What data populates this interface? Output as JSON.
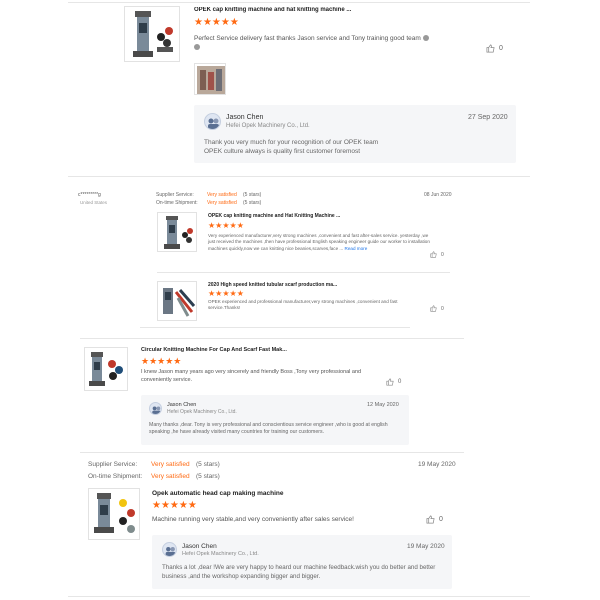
{
  "colors": {
    "accent": "#ff6a13",
    "link": "#1a73e8"
  },
  "review1": {
    "product_title": "OPEK cap knitting machine and hat knitting machine ...",
    "stars": "★★★★★",
    "text": "Perfect Service delivery fast thanks Jason service and Tony training good team",
    "like_count": "0",
    "reply": {
      "name": "Jason Chen",
      "company": "Hefei Opek Machinery Co., Ltd.",
      "date": "27 Sep 2020",
      "text_line1": "Thank you very much for your recognition of our OPEK team",
      "text_line2": "OPEK  culture always is quality first  customer foremost"
    }
  },
  "review2": {
    "user": "c*********g",
    "country": "United States",
    "supplier_service_label": "Supplier Service:",
    "supplier_service_value": "Very satisfied",
    "supplier_service_stars": "(5 stars)",
    "ontime_label": "On-time Shipment:",
    "ontime_value": "Very satisfied",
    "ontime_stars": "(5 stars)",
    "date": "08 Jun 2020",
    "item1": {
      "title": "OPEK cap knitting machine and Hat Knitting Machine ...",
      "stars": "★★★★★",
      "text": "Very experienced manufacturer,very strong machines ,convenient and fast after-sales service. yesterday ,we just received the machines ,then have professional English speaking engineer guide our worker to installation machines quickly,now we can knitting nice beanies,scarves,face ...",
      "read_more": "Read more",
      "like_count": "0"
    },
    "item2": {
      "title": "2020 High speed knitted tubular scarf production ma...",
      "stars": "★★★★★",
      "text": "OPEK experienced and professional manufacturer,very strong machines ,convenient and fast service.Thanks!",
      "like_count": "0"
    }
  },
  "review3": {
    "product_title": "Circular Knitting Machine For Cap And Scarf Fast Mak...",
    "stars": "★★★★★",
    "text": "I knew Jason many years ago very sincerely and friendly Boss ,Tony very professional and conveniently service.",
    "like_count": "0",
    "reply": {
      "name": "Jason Chen",
      "company": "Hefei Opek Machinery Co., Ltd.",
      "date": "12 May 2020",
      "text": "Many thanks ,dear. Tony is very professional and conscientious service engineer ,who is good at english speaking ,he have already visited many countries for training our customers."
    }
  },
  "review4": {
    "supplier_service_label": "Supplier Service:",
    "supplier_service_value": "Very satisfied",
    "supplier_service_stars": "(5 stars)",
    "ontime_label": "On-time Shipment:",
    "ontime_value": "Very satisfied",
    "ontime_stars": "(5 stars)",
    "date": "19 May 2020",
    "product_title": "Opek automatic head cap making machine",
    "stars": "★★★★★",
    "text": "Machine running very stable,and very conveniently after sales service!",
    "like_count": "0",
    "reply": {
      "name": "Jason Chen",
      "company": "Hefei Opek Machinery Co., Ltd.",
      "date": "19 May 2020",
      "text": "Thanks a lot ,dear !We are very happy to heard our machine feedback.wish you do better and better business ,and the workshop expanding bigger and bigger."
    }
  }
}
